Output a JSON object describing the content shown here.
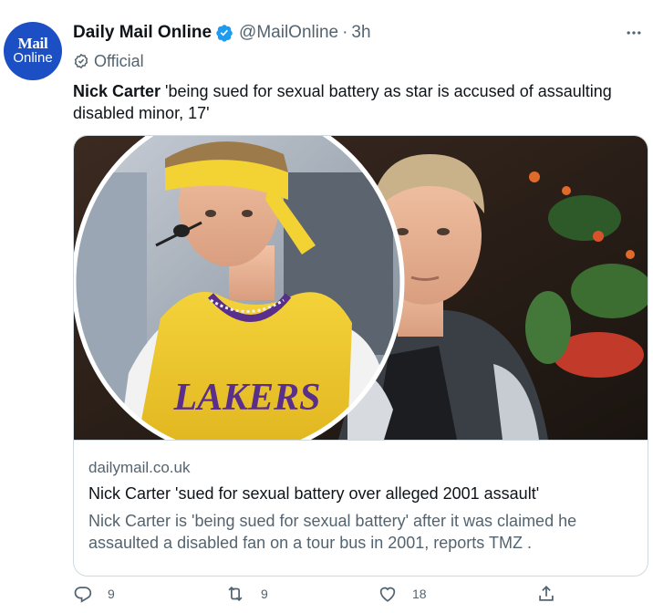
{
  "tweet": {
    "avatar": {
      "line1": "Mail",
      "line2": "Online"
    },
    "name": "Daily Mail Online",
    "handle": "@MailOnline",
    "separator": "·",
    "time": "3h",
    "badge": "Official",
    "text_bold": "Nick Carter",
    "text_rest": " 'being sued for sexual battery as star is accused of assaulting disabled minor, 17'",
    "more_icon": "more-horizontal-icon"
  },
  "card": {
    "domain": "dailymail.co.uk",
    "title": "Nick Carter 'sued for sexual battery over alleged 2001 assault'",
    "description": "Nick Carter is 'being sued for sexual battery' after it was claimed he assaulted a disabled fan on a tour bus in 2001, reports TMZ .",
    "jersey_text": "LAKERS"
  },
  "actions": {
    "reply_count": "9",
    "retweet_count": "9",
    "like_count": "18"
  },
  "colors": {
    "verified": "#1d9bf0",
    "secondary_text": "#536471",
    "brand": "#1d4fc4",
    "border": "#cfd9de"
  }
}
